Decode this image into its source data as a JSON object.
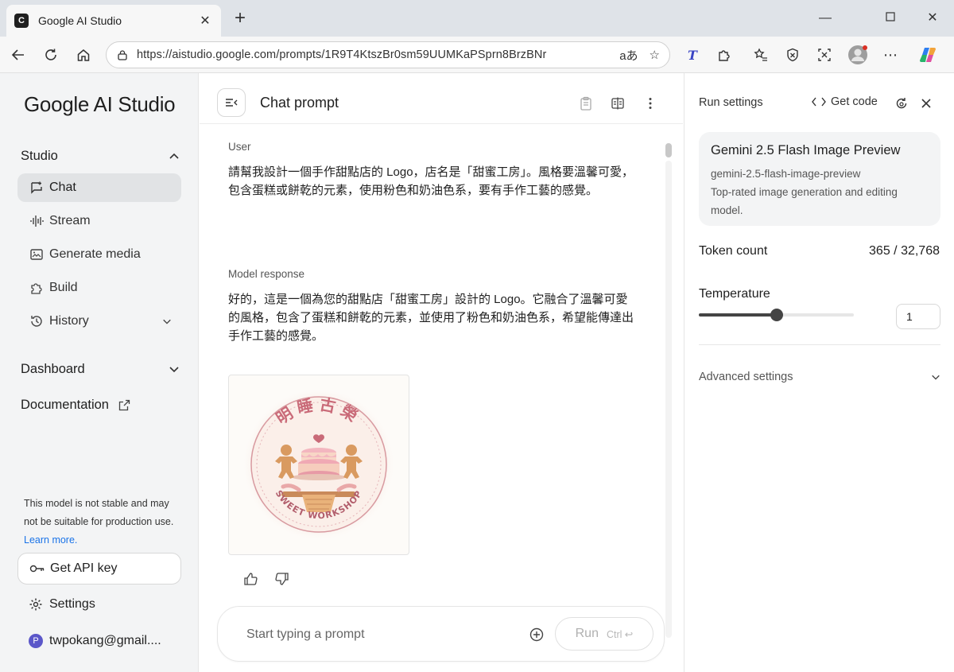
{
  "browser": {
    "tab_title": "Google AI Studio",
    "tab_favicon": "C",
    "url": "https://aistudio.google.com/prompts/1R9T4KtszBr0sm59UUMKaPSprn8BrzBNr",
    "read_aloud": "aあ"
  },
  "sidebar": {
    "brand": "Google AI Studio",
    "studio_label": "Studio",
    "items": [
      {
        "label": "Chat",
        "icon": "chat-icon"
      },
      {
        "label": "Stream",
        "icon": "stream-icon"
      },
      {
        "label": "Generate media",
        "icon": "media-icon"
      },
      {
        "label": "Build",
        "icon": "build-icon"
      },
      {
        "label": "History",
        "icon": "history-icon"
      }
    ],
    "dashboard_label": "Dashboard",
    "documentation_label": "Documentation",
    "notice_text": "This model is not stable and may not be suitable for production use.",
    "notice_link": "Learn more.",
    "api_key_label": "Get API key",
    "settings_label": "Settings",
    "account": "twpokang@gmail....",
    "account_initial": "P"
  },
  "main": {
    "title": "Chat prompt",
    "user_role": "User",
    "user_message": "請幫我設計一個手作甜點店的 Logo，店名是「甜蜜工房」。風格要溫馨可愛，包含蛋糕或餅乾的元素，使用粉色和奶油色系，要有手作工藝的感覺。",
    "model_role": "Model response",
    "model_message": "好的，這是一個為您的甜點店「甜蜜工房」設計的 Logo。它融合了溫馨可愛的風格，包含了蛋糕和餅乾的元素，並使用了粉色和奶油色系，希望能傳達出手作工藝的感覺。",
    "logo_top_text": "明睡古榮",
    "logo_bottom_text": "SWEET WORKSHOP",
    "prompt_placeholder": "Start typing a prompt",
    "run_label": "Run",
    "run_shortcut": "Ctrl ↩"
  },
  "panel": {
    "title": "Run settings",
    "get_code": "Get code",
    "model_name": "Gemini 2.5 Flash Image Preview",
    "model_id": "gemini-2.5-flash-image-preview",
    "model_desc": "Top-rated image generation and editing model.",
    "token_label": "Token count",
    "token_value": "365 / 32,768",
    "temperature_label": "Temperature",
    "temperature_value": "1",
    "temperature_fraction": 0.5,
    "advanced_label": "Advanced settings"
  },
  "colors": {
    "accent_link": "#1a73e8",
    "logo_pink": "#c96a78",
    "avatar": "#5b57c9"
  }
}
